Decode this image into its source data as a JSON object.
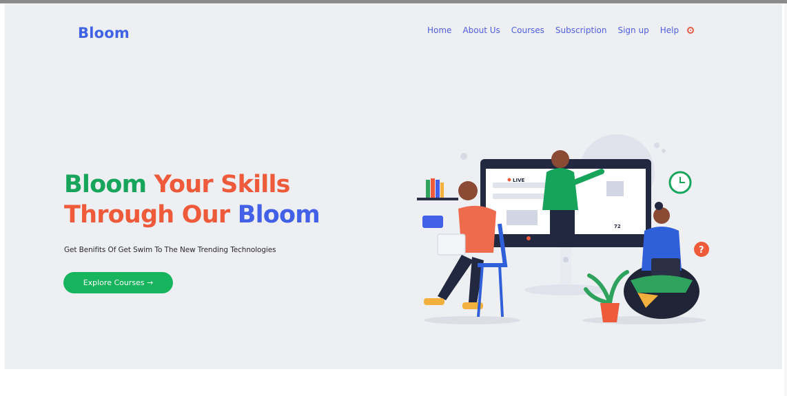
{
  "brand": "Bloom",
  "nav": {
    "items": [
      {
        "label": "Home"
      },
      {
        "label": "About Us"
      },
      {
        "label": "Courses"
      },
      {
        "label": "Subscription"
      },
      {
        "label": "Sign up"
      },
      {
        "label": "Help"
      }
    ],
    "settings_icon": "settings-icon"
  },
  "hero": {
    "headline_line1_part1": "Bloom",
    "headline_line1_part2": "Your Skills",
    "headline_line2_part1": "Through Our",
    "headline_line2_part2": "Bloom",
    "subtitle": "Get Benifits Of Get Swim To The New Trending Technologies",
    "cta_label": "Explore Courses →",
    "live_badge": "LIVE",
    "viewers": "72"
  },
  "colors": {
    "brand_blue": "#3f62e6",
    "green": "#17a55b",
    "orange_red": "#ef5a3b",
    "hero_bg": "#eeeff3"
  }
}
